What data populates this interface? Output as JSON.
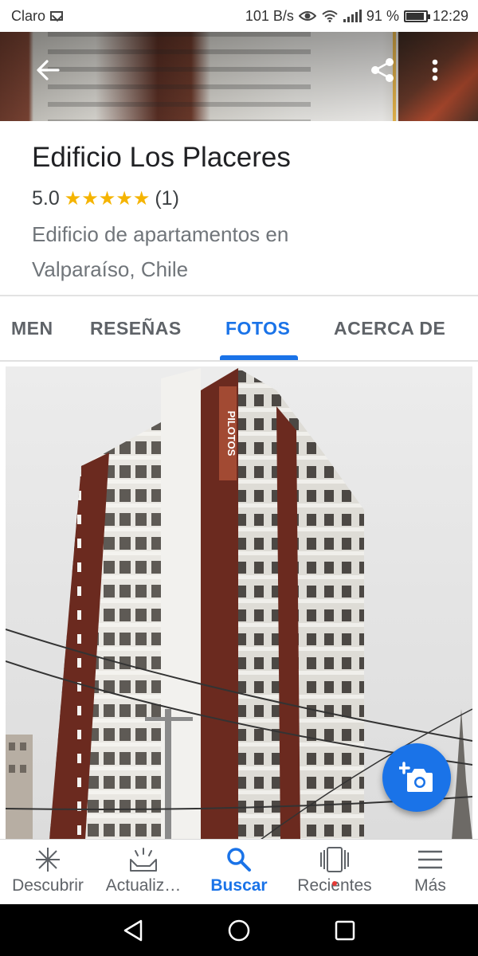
{
  "status_bar": {
    "carrier": "Claro",
    "speed": "101 B/s",
    "battery_percent": "91 %",
    "time": "12:29",
    "icons": [
      "mail-icon",
      "eye-icon",
      "wifi-icon",
      "signal-icon",
      "battery-icon"
    ]
  },
  "header": {
    "back_icon": "arrow-left-icon",
    "share_icon": "share-icon",
    "more_icon": "more-vert-icon"
  },
  "place": {
    "title": "Edificio Los Placeres",
    "rating": "5.0",
    "stars": "★★★★★",
    "review_count": "(1)",
    "description": "Edificio de apartamentos en Valparaíso, Chile"
  },
  "tabs": [
    {
      "label": "MEN",
      "active": false
    },
    {
      "label": "RESEÑAS",
      "active": false
    },
    {
      "label": "FOTOS",
      "active": true
    },
    {
      "label": "ACERCA DE",
      "active": false
    }
  ],
  "photo": {
    "sign_text": "PILOTOS"
  },
  "fab": {
    "icon": "add-photo-icon"
  },
  "bottom_nav": [
    {
      "label": "Descubrir",
      "icon": "sparkle-icon",
      "active": false
    },
    {
      "label": "Actualiz…",
      "icon": "inbox-updates-icon",
      "active": false
    },
    {
      "label": "Buscar",
      "icon": "search-icon",
      "active": true
    },
    {
      "label": "Recientes",
      "icon": "recents-icon",
      "active": false
    },
    {
      "label": "Más",
      "icon": "menu-icon",
      "active": false
    }
  ],
  "system_nav": [
    "back-triangle-icon",
    "home-circle-icon",
    "overview-square-icon"
  ],
  "colors": {
    "accent": "#1a73e8",
    "star": "#f5b400",
    "building_brown": "#6b2a1f"
  }
}
